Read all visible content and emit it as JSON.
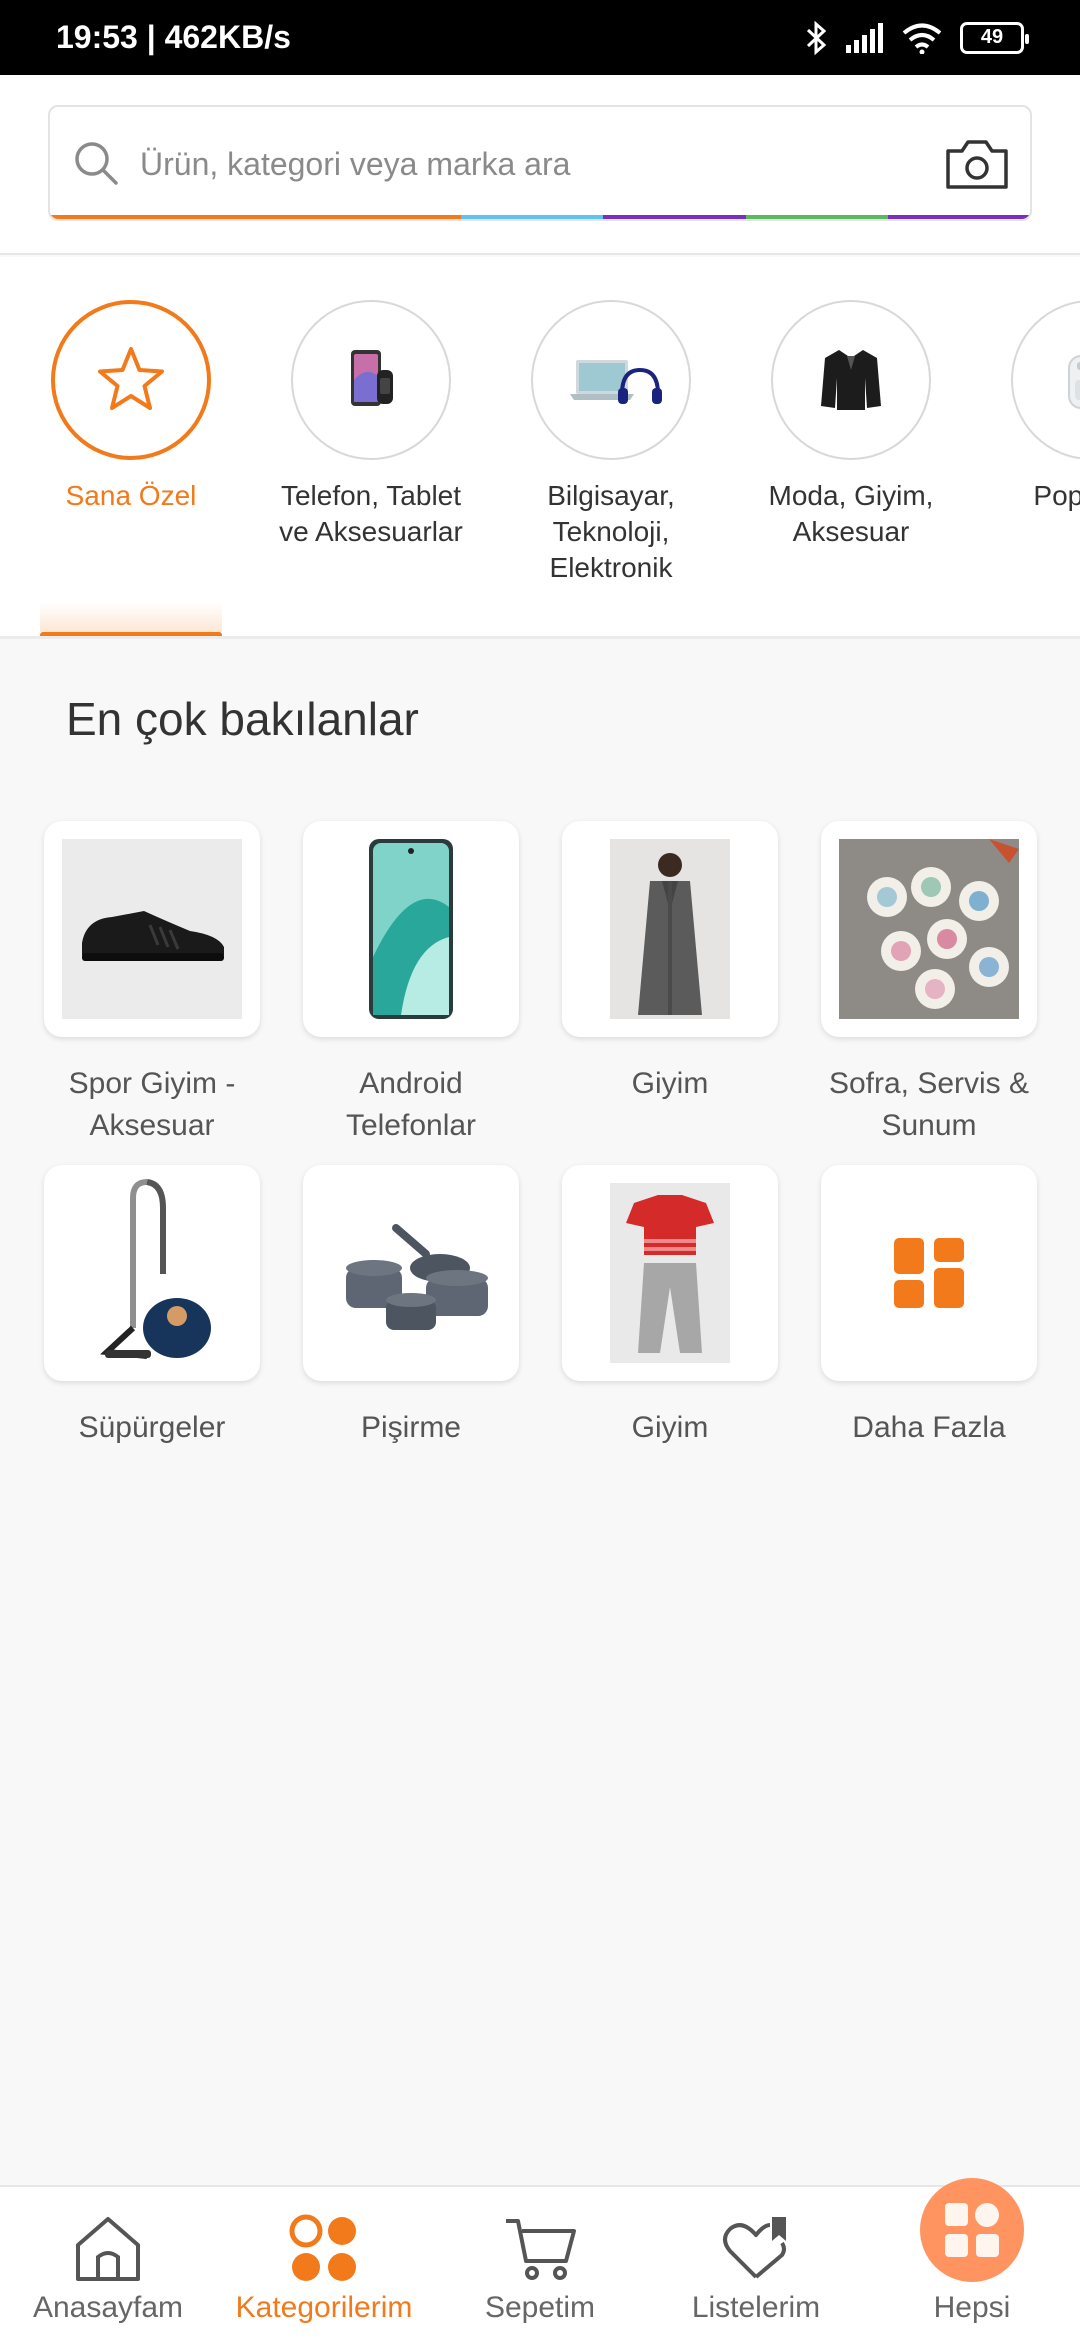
{
  "status_bar": {
    "time_speed": "19:53 | 462KB/s",
    "battery": "49"
  },
  "search": {
    "placeholder": "Ürün, kategori veya marka ara"
  },
  "categories": [
    {
      "label": "Sana Özel",
      "active": true,
      "icon": "star-icon"
    },
    {
      "label": "Telefon, Tablet ve Aksesuarlar",
      "icon": "phone-watch-image"
    },
    {
      "label": "Bilgisayar, Teknoloji, Elektronik",
      "icon": "laptop-headphones-image"
    },
    {
      "label": "Moda, Giyim, Aksesuar",
      "icon": "jacket-image"
    },
    {
      "label": "Pop Kate",
      "icon": "air-fryer-image"
    }
  ],
  "section": {
    "title": "En çok bakılanlar"
  },
  "most_viewed": [
    {
      "label": "Spor Giyim - Aksesuar",
      "icon": "sneaker-image"
    },
    {
      "label": "Android Telefonlar",
      "icon": "android-phone-image"
    },
    {
      "label": "Giyim",
      "icon": "coat-image"
    },
    {
      "label": "Sofra, Servis & Sunum",
      "icon": "plates-image"
    },
    {
      "label": "Süpürgeler",
      "icon": "vacuum-image"
    },
    {
      "label": "Pişirme",
      "icon": "cookware-image"
    },
    {
      "label": "Giyim",
      "icon": "kids-outfit-image"
    },
    {
      "label": "Daha Fazla",
      "icon": "grid-icon"
    }
  ],
  "bottom_nav": [
    {
      "label": "Anasayfam",
      "icon": "home-icon"
    },
    {
      "label": "Kategorilerim",
      "icon": "categories-icon",
      "active": true
    },
    {
      "label": "Sepetim",
      "icon": "cart-icon"
    },
    {
      "label": "Listelerim",
      "icon": "heart-list-icon"
    },
    {
      "label": "Hepsi",
      "icon": "apps-icon"
    }
  ],
  "colors": {
    "accent": "#f27a1a",
    "rainbow": [
      "#f27a1a",
      "#5ec3f0",
      "#7b2fbf",
      "#5cb85c",
      "#7b2fbf"
    ]
  }
}
